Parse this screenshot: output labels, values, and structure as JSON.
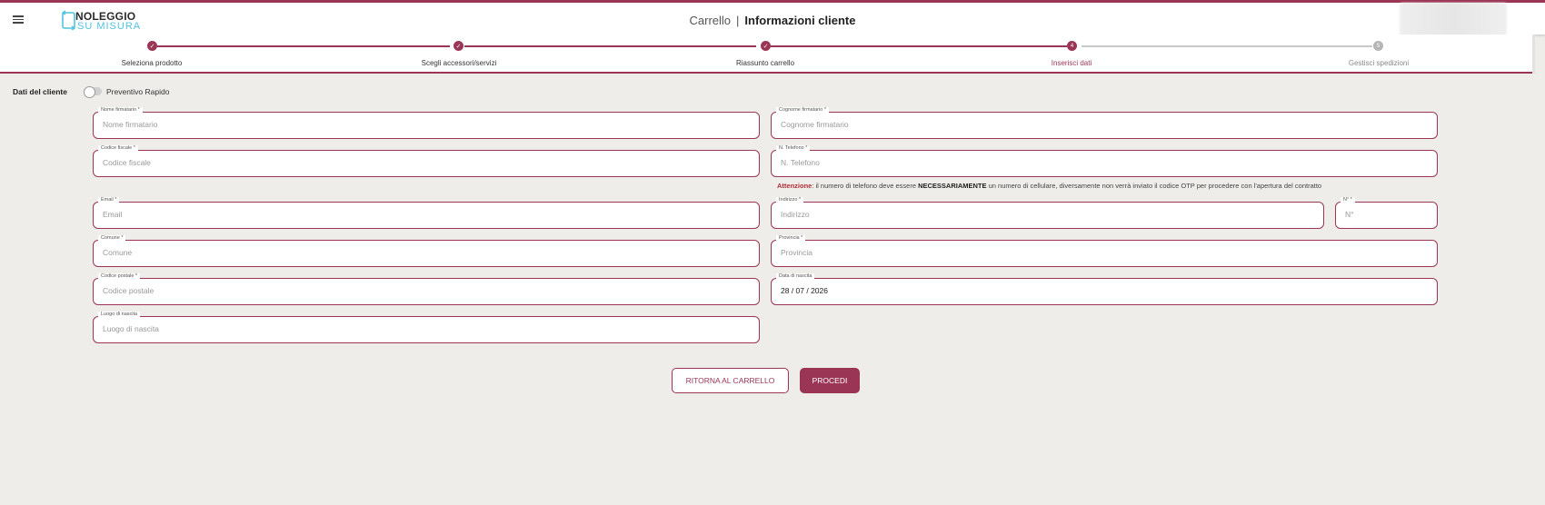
{
  "header": {
    "logo": {
      "line1": "NOLEGGIO",
      "line2": "SU MISURA"
    },
    "breadcrumb": "Carrello",
    "separator": "|",
    "title": "Informazioni cliente"
  },
  "stepper": {
    "steps": [
      {
        "label": "Seleziona prodotto",
        "status": "done",
        "marker": "✓"
      },
      {
        "label": "Scegli accessori/servizi",
        "status": "done",
        "marker": "✓"
      },
      {
        "label": "Riassunto carrello",
        "status": "done",
        "marker": "✓"
      },
      {
        "label": "Inserisci dati",
        "status": "active",
        "marker": "4"
      },
      {
        "label": "Gestisci spedizioni",
        "status": "todo",
        "marker": "5"
      }
    ]
  },
  "form": {
    "section_title": "Dati del cliente",
    "quick_quote_label": "Preventivo Rapido",
    "quick_quote_on": false,
    "fields": {
      "nome": {
        "label": "Nome firmatario *",
        "placeholder": "Nome firmatario",
        "value": ""
      },
      "cognome": {
        "label": "Cognome firmatario *",
        "placeholder": "Cognome firmatario",
        "value": ""
      },
      "codice_fiscale": {
        "label": "Codice fiscale *",
        "placeholder": "Codice fiscale",
        "value": ""
      },
      "telefono": {
        "label": "N. Telefono *",
        "placeholder": "N. Telefono",
        "value": ""
      },
      "email": {
        "label": "Email *",
        "placeholder": "Email",
        "value": ""
      },
      "indirizzo": {
        "label": "Indirizzo *",
        "placeholder": "Indirizzo",
        "value": ""
      },
      "civico": {
        "label": "N° *",
        "placeholder": "N°",
        "value": ""
      },
      "comune": {
        "label": "Comune *",
        "placeholder": "Comune",
        "value": ""
      },
      "provincia": {
        "label": "Provincia *",
        "placeholder": "Provincia",
        "value": ""
      },
      "cap": {
        "label": "Codice postale *",
        "placeholder": "Codice postale",
        "value": ""
      },
      "data_nascita": {
        "label": "Data di nascita",
        "placeholder": "",
        "value": "28 / 07 / 2026"
      },
      "luogo_nascita": {
        "label": "Luogo di nascita",
        "placeholder": "Luogo di nascita",
        "value": ""
      }
    },
    "warning": {
      "label": "Attenzione",
      "text_before": ": il numero di telefono deve essere ",
      "emphasis": "NECESSARIAMENTE",
      "text_after": " un numero di cellulare, diversamente non verrà inviato il codice OTP per procedere con l'apertura del contratto"
    }
  },
  "actions": {
    "back_label": "RITORNA AL CARRELLO",
    "proceed_label": "PROCEDI"
  },
  "colors": {
    "accent": "#9b3556",
    "background": "#efedea",
    "logo_blue": "#4fc3e0",
    "inactive": "#b5b5b5"
  }
}
